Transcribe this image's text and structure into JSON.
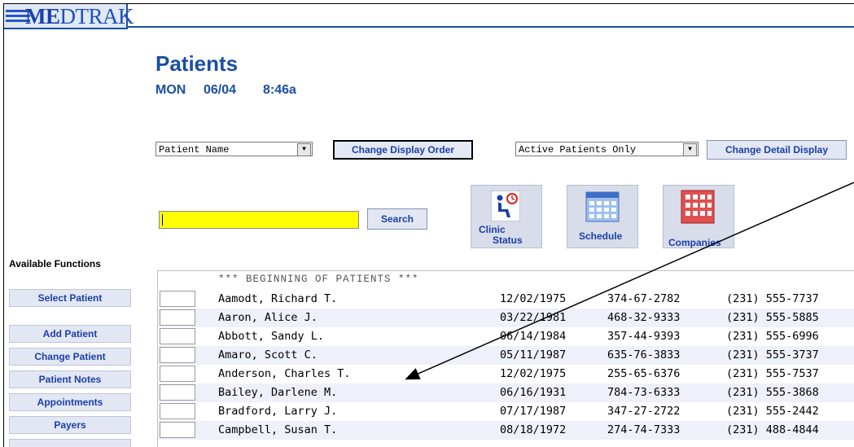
{
  "header": {
    "logo_text": "MEDTRAK"
  },
  "page": {
    "title": "Patients",
    "day": "MON",
    "date": "06/04",
    "time": "8:46a"
  },
  "controls": {
    "sort_select_value": "Patient Name",
    "change_order_label": "Change Display Order",
    "filter_select_value": "Active Patients Only",
    "change_detail_label": "Change Detail Display",
    "search_value": "",
    "search_label": "Search"
  },
  "tools": [
    {
      "label_line1": "Clinic",
      "label_line2": "Status",
      "icon": "clinic-status-icon"
    },
    {
      "label": "Schedule",
      "icon": "schedule-icon"
    },
    {
      "label": "Companies",
      "icon": "companies-icon"
    }
  ],
  "sidebar": {
    "title": "Available Functions",
    "items": [
      {
        "label": "Select Patient"
      },
      {
        "label": "Add Patient"
      },
      {
        "label": "Change Patient"
      },
      {
        "label": "Patient Notes"
      },
      {
        "label": "Appointments"
      },
      {
        "label": "Payers"
      }
    ]
  },
  "list": {
    "header": "*** BEGINNING OF PATIENTS ***",
    "rows": [
      {
        "name": "Aamodt, Richard T.",
        "dob": "12/02/1975",
        "ssn": "374-67-2782",
        "phone": "(231) 555-7737"
      },
      {
        "name": "Aaron, Alice J.",
        "dob": "03/22/1981",
        "ssn": "468-32-9333",
        "phone": "(231) 555-5885"
      },
      {
        "name": "Abbott, Sandy L.",
        "dob": "06/14/1984",
        "ssn": "357-44-9393",
        "phone": "(231) 555-6996"
      },
      {
        "name": "Amaro, Scott C.",
        "dob": "05/11/1987",
        "ssn": "635-76-3833",
        "phone": "(231) 555-3737"
      },
      {
        "name": "Anderson, Charles T.",
        "dob": "12/02/1975",
        "ssn": "255-65-6376",
        "phone": "(231) 555-7537"
      },
      {
        "name": "Bailey, Darlene M.",
        "dob": "06/16/1931",
        "ssn": "784-73-6333",
        "phone": "(231) 555-3868"
      },
      {
        "name": "Bradford, Larry J.",
        "dob": "07/17/1987",
        "ssn": "347-27-2722",
        "phone": "(231) 555-2442"
      },
      {
        "name": "Campbell, Susan T.",
        "dob": "08/18/1972",
        "ssn": "274-74-7333",
        "phone": "(231) 488-4844"
      }
    ]
  },
  "colors": {
    "accent": "#1a4fa3",
    "search_bg": "#ffff00",
    "row_alt": "#eef1fa"
  }
}
